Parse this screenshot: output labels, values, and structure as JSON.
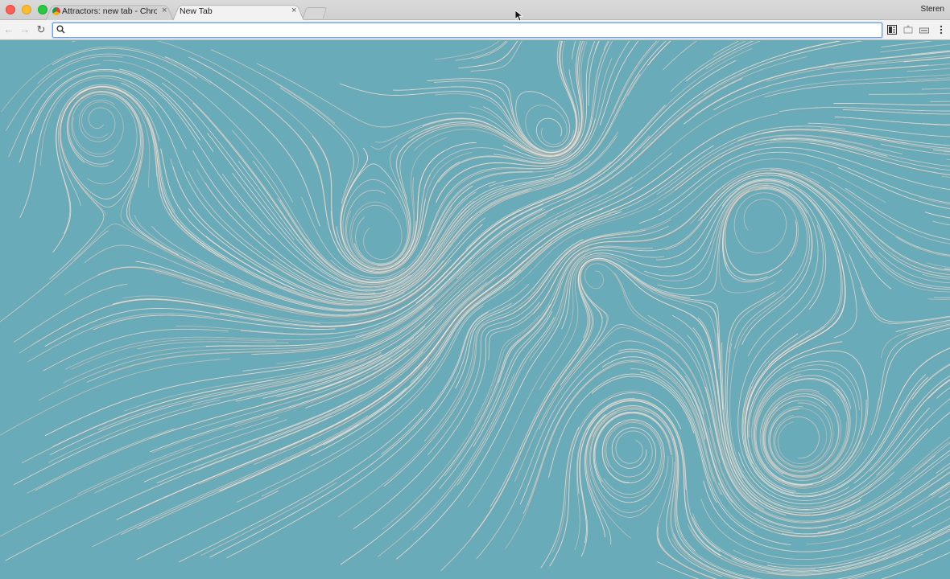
{
  "browser": {
    "profile_name": "Steren",
    "tabs": [
      {
        "title": "Attractors: new tab - Chrome",
        "active": false
      },
      {
        "title": "New Tab",
        "active": true
      }
    ],
    "omnibox": {
      "value": "",
      "placeholder": ""
    },
    "icons": {
      "back": "arrow-left-icon",
      "forward": "arrow-right-icon",
      "reload": "reload-icon",
      "search": "search-icon",
      "menu": "more-vertical-icon"
    }
  },
  "page": {
    "background_color": "#6aabb9",
    "line_color": "#f3eee8"
  }
}
